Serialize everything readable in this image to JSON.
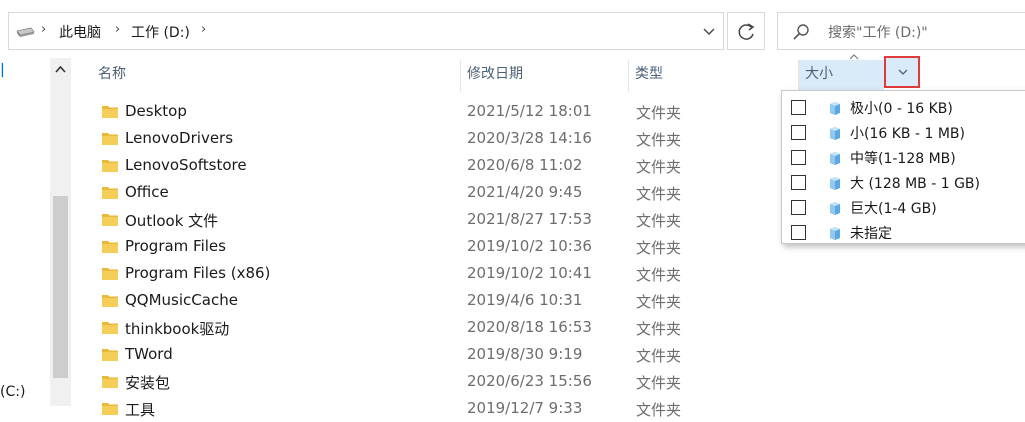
{
  "address": {
    "crumbs": [
      "此电脑",
      "工作 (D:)"
    ]
  },
  "search": {
    "placeholder": "搜索\"工作 (D:)\""
  },
  "nav": {
    "partial_drive_label": "(C:)"
  },
  "columns": {
    "name": "名称",
    "date": "修改日期",
    "type": "类型",
    "size": "大小"
  },
  "files": [
    {
      "name": "Desktop",
      "date": "2021/5/12 18:01",
      "type": "文件夹"
    },
    {
      "name": "LenovoDrivers",
      "date": "2020/3/28 14:16",
      "type": "文件夹"
    },
    {
      "name": "LenovoSoftstore",
      "date": "2020/6/8 11:02",
      "type": "文件夹"
    },
    {
      "name": "Office",
      "date": "2021/4/20 9:45",
      "type": "文件夹"
    },
    {
      "name": "Outlook 文件",
      "date": "2021/8/27 17:53",
      "type": "文件夹"
    },
    {
      "name": "Program Files",
      "date": "2019/10/2 10:36",
      "type": "文件夹"
    },
    {
      "name": "Program Files (x86)",
      "date": "2019/10/2 10:41",
      "type": "文件夹"
    },
    {
      "name": "QQMusicCache",
      "date": "2019/4/6 10:31",
      "type": "文件夹"
    },
    {
      "name": "thinkbook驱动",
      "date": "2020/8/18 16:53",
      "type": "文件夹"
    },
    {
      "name": "TWord",
      "date": "2019/8/30 9:19",
      "type": "文件夹"
    },
    {
      "name": "安装包",
      "date": "2020/6/23 15:56",
      "type": "文件夹"
    },
    {
      "name": "工具",
      "date": "2019/12/7 9:33",
      "type": "文件夹"
    }
  ],
  "size_filter": {
    "options": [
      {
        "label": "极小(0 - 16 KB)",
        "checked": false
      },
      {
        "label": "小(16 KB - 1 MB)",
        "checked": false
      },
      {
        "label": "中等(1-128 MB)",
        "checked": false
      },
      {
        "label": "大 (128 MB - 1 GB)",
        "checked": false
      },
      {
        "label": "巨大(1-4 GB)",
        "checked": false
      },
      {
        "label": "未指定",
        "checked": false
      }
    ]
  },
  "colors": {
    "header_text": "#4c607a",
    "sorted_column_bg": "#d9ebf9",
    "highlight_border": "#e03a3a",
    "folder": "#f2c94c",
    "size_cube": "#5aa9e6"
  },
  "icons": {
    "drive": "drive-icon",
    "search": "search-icon",
    "refresh": "refresh-icon",
    "folder": "folder-icon",
    "filter": "chevron-down-icon",
    "size_group": "cube-icon"
  }
}
